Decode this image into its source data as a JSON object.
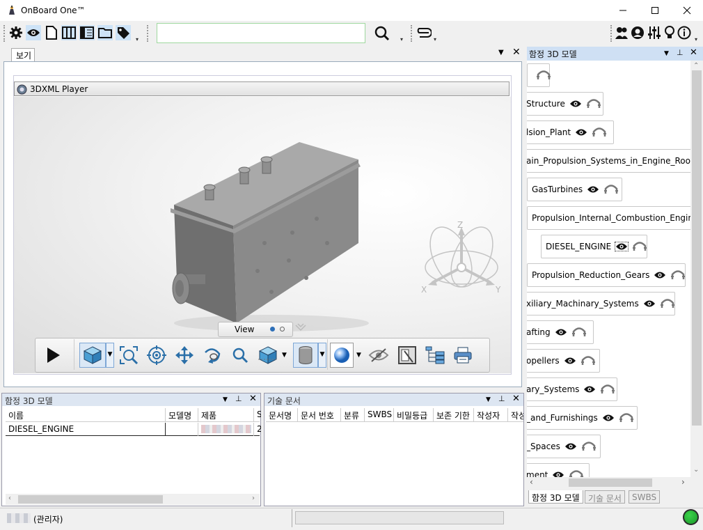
{
  "window": {
    "title": "OnBoard One™"
  },
  "viewer": {
    "tab_label": "보기",
    "player_title": "3DXML Player",
    "view_popup_label": "View"
  },
  "axes": {
    "z": "Z",
    "x": "X",
    "y": "Y"
  },
  "bottom_left": {
    "title": "함정 3D 모델",
    "columns": [
      "이름",
      "모델명",
      "제품",
      "S"
    ],
    "rows": [
      {
        "name": "DIESEL_ENGINE",
        "model": "",
        "product": "",
        "s": "2"
      }
    ]
  },
  "bottom_mid": {
    "title": "기술 문서",
    "columns": [
      "문서명",
      "문서 번호",
      "분류",
      "SWBS",
      "비밀등급",
      "보존 기한",
      "작성자",
      "작성"
    ]
  },
  "right_panel": {
    "title": "함정 3D 모델",
    "nodes": [
      {
        "label": ""
      },
      {
        "label": "Structure"
      },
      {
        "label": "lsion_Plant"
      },
      {
        "label": "ain_Propulsion_Systems_in_Engine_Room"
      },
      {
        "label": "GasTurbines"
      },
      {
        "label": "Propulsion_Internal_Combustion_Engine"
      },
      {
        "label": "DIESEL_ENGINE"
      },
      {
        "label": "Propulsion_Reduction_Gears"
      },
      {
        "label": "xiliary_Machinary_Systems"
      },
      {
        "label": "afting"
      },
      {
        "label": "opellers"
      },
      {
        "label": "ary_Systems"
      },
      {
        "label": "_and_Furnishings"
      },
      {
        "label": "_Spaces"
      },
      {
        "label": "ment"
      }
    ],
    "tabs": [
      "함정 3D 모델",
      "기술 문서",
      "SWBS"
    ]
  },
  "status": {
    "user_suffix": "(관리자)",
    "connection_color": "#1a9a2a"
  },
  "icons": [
    "gear-icon",
    "eye-icon",
    "document-icon",
    "columns-icon",
    "book-icon",
    "folder-icon",
    "tag-icon",
    "search-icon",
    "attachment-icon",
    "users-icon",
    "account-icon",
    "settings-sliders-icon",
    "lightbulb-icon",
    "info-icon"
  ]
}
